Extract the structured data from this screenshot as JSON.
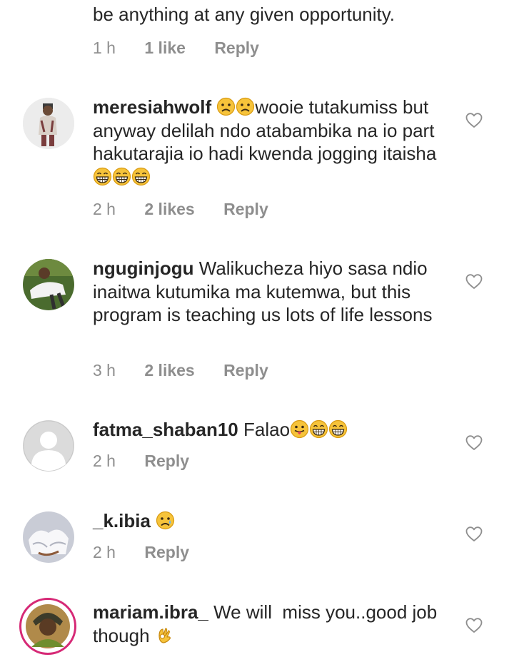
{
  "comments": [
    {
      "text": "be anything at any given opportunity.",
      "time": "1 h",
      "likes": "1 like",
      "reply": "Reply"
    },
    {
      "user": "meresiahwolf",
      "text_before": "",
      "text_after": "wooie tutakumiss but anyway delilah ndo atabambika na io part hakutarajia io hadi kwenda jogging itaisha",
      "time": "2 h",
      "likes": "2 likes",
      "reply": "Reply",
      "emojis_before": [
        "sad-face-emoji",
        "sad-face-emoji"
      ],
      "emojis_after": [
        "grin-emoji",
        "grin-emoji",
        "grin-emoji"
      ]
    },
    {
      "user": "nguginjogu",
      "text": "Walikucheza hiyo sasa ndio inaitwa kutumika ma kutemwa, but this program is teaching us lots of life lessons",
      "time": "3 h",
      "likes": "2 likes",
      "reply": "Reply"
    },
    {
      "user": "fatma_shaban10",
      "text": "Falao",
      "time": "2 h",
      "reply": "Reply",
      "emojis": [
        "tongue-face-emoji",
        "grin-emoji",
        "grin-emoji"
      ]
    },
    {
      "user": "_k.ibia",
      "text": "",
      "time": "2 h",
      "reply": "Reply",
      "emojis": [
        "sad-tear-emoji"
      ]
    },
    {
      "user": "mariam.ibra_",
      "text": "We will  miss you..good job though",
      "emojis": [
        "ok-hand-emoji"
      ]
    }
  ]
}
